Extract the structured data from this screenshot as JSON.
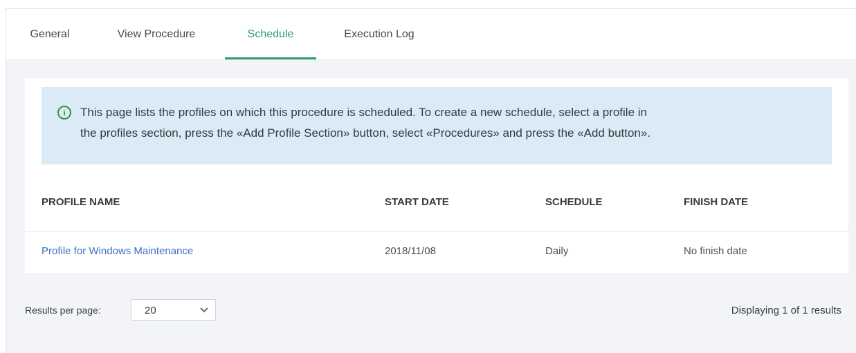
{
  "tabs": [
    {
      "label": "General",
      "active": false
    },
    {
      "label": "View Procedure",
      "active": false
    },
    {
      "label": "Schedule",
      "active": true
    },
    {
      "label": "Execution Log",
      "active": false
    }
  ],
  "info": {
    "icon": "info-icon",
    "line1": "This page lists the profiles on which this procedure is scheduled. To create a new schedule, select a profile in",
    "line2": "the profiles section, press the «Add Profile Section» button, select «Procedures» and press the «Add button»."
  },
  "table": {
    "columns": [
      "PROFILE NAME",
      "START DATE",
      "SCHEDULE",
      "FINISH DATE"
    ],
    "rows": [
      {
        "profile_name": "Profile for Windows Maintenance",
        "start_date": "2018/11/08",
        "schedule": "Daily",
        "finish_date": "No finish date"
      }
    ]
  },
  "pagination": {
    "results_per_page_label": "Results per page:",
    "results_per_page_value": "20",
    "summary": "Displaying 1 of 1 results"
  },
  "colors": {
    "accent": "#2c9a7a",
    "link": "#3d6fb8",
    "info_bg": "#dbebf6",
    "info_icon": "#3e8f3e"
  }
}
